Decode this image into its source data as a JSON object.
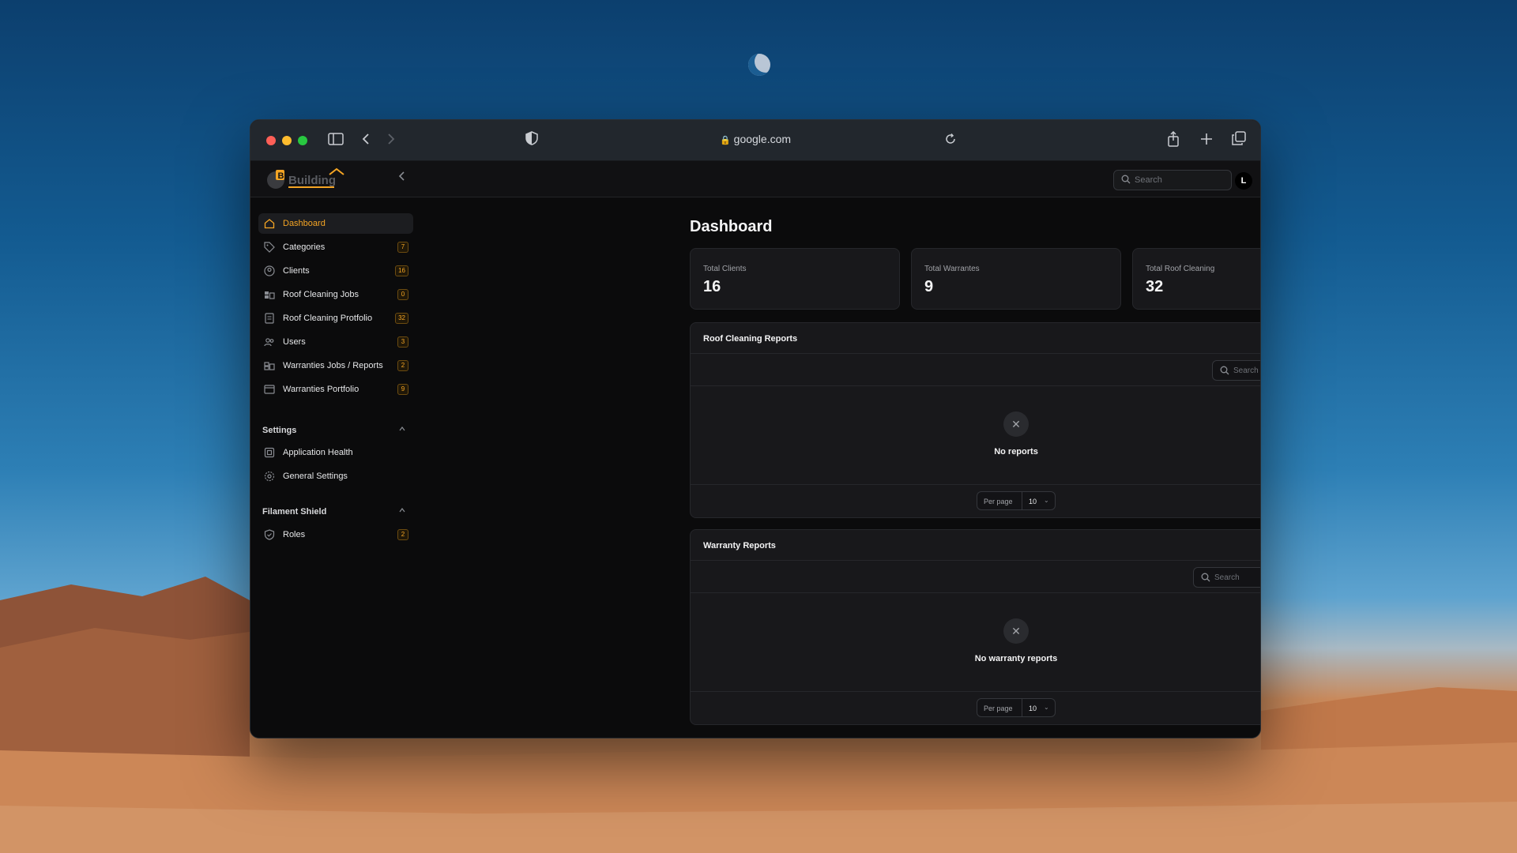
{
  "browser": {
    "url": "google.com",
    "icons": [
      "sidebar-toggle-icon",
      "back-icon",
      "forward-icon",
      "shield-icon",
      "lock-icon",
      "reload-icon",
      "share-icon",
      "plus-icon",
      "tabs-icon"
    ]
  },
  "header": {
    "logo_text": "Building",
    "search_placeholder": "Search",
    "avatar_initial": "L"
  },
  "sidebar": {
    "items": [
      {
        "label": "Dashboard",
        "icon": "home-icon",
        "badge": ""
      },
      {
        "label": "Categories",
        "icon": "tag-icon",
        "badge": "7"
      },
      {
        "label": "Clients",
        "icon": "user-circle-icon",
        "badge": "16"
      },
      {
        "label": "Roof Cleaning Jobs",
        "icon": "briefcase-icon",
        "badge": "0"
      },
      {
        "label": "Roof Cleaning Protfolio",
        "icon": "document-icon",
        "badge": "32"
      },
      {
        "label": "Users",
        "icon": "users-icon",
        "badge": "3"
      },
      {
        "label": "Warranties Jobs / Reports",
        "icon": "clipboard-icon",
        "badge": "2"
      },
      {
        "label": "Warranties Portfolio",
        "icon": "archive-icon",
        "badge": "9"
      }
    ],
    "settings": {
      "title": "Settings",
      "items": [
        {
          "label": "Application Health",
          "icon": "cpu-icon"
        },
        {
          "label": "General Settings",
          "icon": "cog-icon"
        }
      ]
    },
    "shield": {
      "title": "Filament Shield",
      "items": [
        {
          "label": "Roles",
          "icon": "shield-check-icon",
          "badge": "2"
        }
      ]
    }
  },
  "main": {
    "title": "Dashboard",
    "stats": [
      {
        "label": "Total Clients",
        "value": "16"
      },
      {
        "label": "Total Warrantes",
        "value": "9"
      },
      {
        "label": "Total Roof Cleaning",
        "value": "32"
      }
    ],
    "roof_reports": {
      "title": "Roof Cleaning Reports",
      "search_placeholder": "Search",
      "empty_text": "No reports",
      "per_page_label": "Per page",
      "per_page_value": "10"
    },
    "warranty_reports": {
      "title": "Warranty Reports",
      "search_placeholder": "Search",
      "empty_text": "No warranty reports",
      "per_page_label": "Per page",
      "per_page_value": "10"
    }
  },
  "colors": {
    "accent": "#f5a524",
    "panel": "#18181b",
    "background": "#0b0b0c"
  }
}
